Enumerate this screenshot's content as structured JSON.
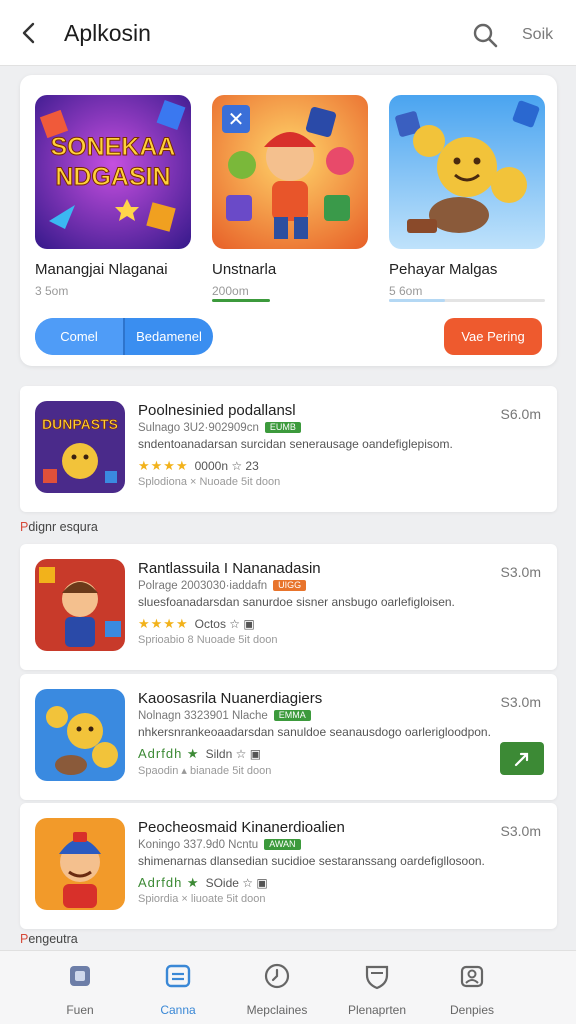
{
  "header": {
    "title": "Aplkosin",
    "right_link": "Soik"
  },
  "featured": {
    "cards": [
      {
        "name": "Manangjai Nlaganai",
        "sub": "3 5om",
        "art_text_1": "SONEKAA",
        "art_text_2": "NDGASIN"
      },
      {
        "name": "Unstnarla",
        "sub": "200om"
      },
      {
        "name": "Pehayar Malgas",
        "sub": "5 6om"
      }
    ],
    "seg_left": "Comel",
    "seg_right": "Bedamenel",
    "orange_button": "Vae Pering"
  },
  "apps": [
    {
      "title": "Poolnesinied podallansl",
      "meta": "Sulnago 3U2·902909cn",
      "badge": "EUMB",
      "badge_color": "#3c9a3c",
      "desc": "sndentoanadarsan surcidan senerausage oandefiglepisom.",
      "stars": "★★★★",
      "rating": "0000n ☆ 23",
      "foot": "Splodiona × Nuoade 5it doon",
      "size": "S6.0m",
      "art_text": "DUNPASTS"
    },
    {
      "title": "Rantlassuila I Nananadasin",
      "meta": "Polrage 2003030·iaddafn",
      "badge": "UIGG",
      "badge_color": "#e8742c",
      "desc": "sluesfoanadarsdan sanurdoe sisner ansbugo oarlefigloisen.",
      "stars": "★★★★",
      "rating": "Octos ☆ ▣",
      "foot": "Sprioabio 8 Nuoade 5it doon",
      "size": "S3.0m"
    },
    {
      "title": "Kaoosasrila Nuanerdiagiers",
      "meta": "Nolnagn 3323901 Nlache",
      "badge": "EMMA",
      "badge_color": "#3c9a3c",
      "desc": "nhkersnrankeoaadarsdan sanuldoe seanausdogo oarlerigloodpon.",
      "stars": "Adrfdh ★",
      "rating": "Sildn ☆ ▣",
      "foot": "Spaodin ▴ bianade 5it doon",
      "size": "S3.0m",
      "has_green_button": true
    },
    {
      "title": "Peocheosmaid Kinanerdioalien",
      "meta": "Koningo 337.9d0 Ncntu",
      "badge": "AWAN",
      "badge_color": "#3c9a3c",
      "desc": "shimenarnas dlansedian sucidioe sestaranssang oardefigllosoon.",
      "stars": "Adrfdh ★",
      "rating": "SOide ☆ ▣",
      "foot": "Spiordia × liuoate 5it doon",
      "size": "S3.0m"
    }
  ],
  "sections": {
    "popular": {
      "prefix": "P",
      "rest": "dignr esqura"
    },
    "pengeutra": {
      "prefix": "P",
      "rest": "engeutra"
    }
  },
  "nav": [
    {
      "label": "Fuen",
      "icon": "home-icon"
    },
    {
      "label": "Canna",
      "icon": "apps-icon",
      "active": true
    },
    {
      "label": "Mepclaines",
      "icon": "clock-icon"
    },
    {
      "label": "Plenaprten",
      "icon": "shield-icon"
    },
    {
      "label": "Denpies",
      "icon": "profile-icon"
    }
  ],
  "colors": {
    "accent_blue": "#3a8ef0",
    "accent_orange": "#ee5a2e",
    "accent_green": "#3c8a35",
    "star": "#f2b21b"
  }
}
